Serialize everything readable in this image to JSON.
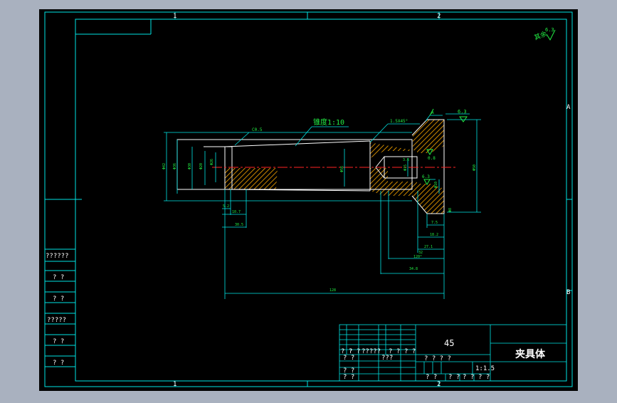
{
  "colors": {
    "background": "#a9b1bf",
    "sheet": "#000000",
    "frame": "#00e5e5",
    "dimension": "#22ee44",
    "section_hatch": "#ffaa00",
    "centerline": "#ff2222",
    "text": "#ffffff",
    "part_outline": "#ffffff"
  },
  "zones": {
    "top": [
      "1",
      "2"
    ],
    "bottom": [
      "1",
      "2"
    ],
    "right": [
      "A",
      "B"
    ]
  },
  "corner_note": "其余",
  "corner_roughness": "6.3",
  "annotations": {
    "taper": "锥度1:10",
    "chamfer_small": "C0.5",
    "chamfer_large": "1.5X45°",
    "perpendicularity": "A",
    "roughness_top": "6.3",
    "roughness_mid": "0.8",
    "roughness_lower": "6.3"
  },
  "dimensions": {
    "d_left_outer": "Φ42",
    "d_left_mid": "Φ36",
    "d_left_inner": "Φ30",
    "d_left_bore": "Φ20",
    "d_mid": "Φ26",
    "d_flange": "Φ56",
    "d_bore_right": "Φ15",
    "d_small": "Φ10",
    "d_step": "Φ8",
    "d_outer_right": "Φ50",
    "len_5_2": "5.2",
    "len_10_7": "10.7",
    "len_30_5": "30.5",
    "len_7_5": "7.5",
    "len_18_2": "18.2",
    "len_27_1": "27.1",
    "len_32": "32",
    "len_34_8": "34.8",
    "len_total": "128",
    "angle": "120°",
    "len_3_6": "3.6"
  },
  "left_panel": [
    "??????",
    "? ?",
    "? ?",
    "?????",
    "? ?",
    "? ?"
  ],
  "title_block": {
    "material": "45",
    "part_name": "夹具体",
    "header_row": [
      "? ?",
      "? ?",
      "?????",
      "? ?",
      "? ?"
    ],
    "row_a": [
      "? ?",
      "???"
    ],
    "row_b": [
      "? ?",
      "? ?"
    ],
    "stage_label": "? ? ? ?",
    "scale": "1:1.5",
    "sheet_row": [
      "? ?",
      "? ?",
      "? ?",
      "? ?"
    ]
  }
}
